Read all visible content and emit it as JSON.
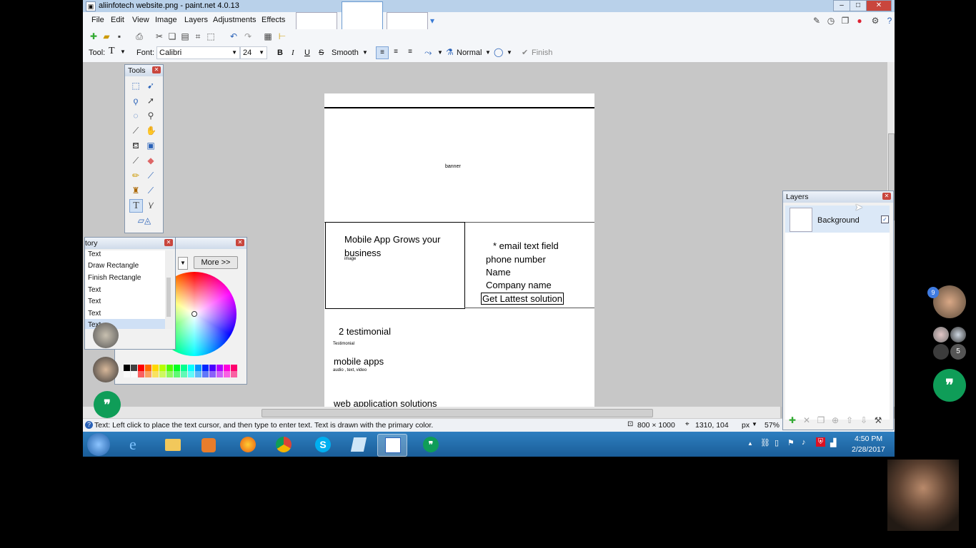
{
  "window": {
    "title": "aliinfotech website.png - paint.net 4.0.13"
  },
  "menu": [
    "File",
    "Edit",
    "View",
    "Image",
    "Layers",
    "Adjustments",
    "Effects"
  ],
  "toolbar2": {
    "tool_label": "Tool:",
    "font_label": "Font:",
    "font_value": "Calibri",
    "size_value": "24",
    "bold": "B",
    "italic": "I",
    "underline": "U",
    "strike": "S",
    "antialias": "Smooth",
    "blend": "Normal",
    "finish": "Finish"
  },
  "tools_panel": {
    "title": "Tools"
  },
  "history_panel": {
    "title": "tory",
    "items": [
      "Text",
      "Draw Rectangle",
      "Finish Rectangle",
      "Text",
      "Text",
      "Text",
      "Text"
    ]
  },
  "colors_panel": {
    "more_label": "More >>",
    "palette": [
      "#000000",
      "#404040",
      "#ff0000",
      "#ff6a00",
      "#ffd800",
      "#b6ff00",
      "#4cff00",
      "#00ff21",
      "#00ff90",
      "#00ffff",
      "#0094ff",
      "#0026ff",
      "#4800ff",
      "#b200ff",
      "#ff00dc",
      "#ff006e"
    ]
  },
  "layers_panel": {
    "title": "Layers",
    "layer_name": "Background"
  },
  "document": {
    "banner": "banner",
    "box_title_1": "Mobile App Grows your",
    "box_title_2": "business",
    "image_label": "image",
    "email": "* email text field",
    "phone": "phone number",
    "name": "Name",
    "company": "Company name",
    "button": "Get Lattest solution",
    "testimonial_heading": "2 testimonial",
    "testimonial_label": "Testimonial",
    "mobile_apps": "mobile apps",
    "mobile_sub": "audio , text, video",
    "web_app": "web application solutions"
  },
  "statusbar": {
    "help": "Text: Left click to place the text cursor, and then type to enter text. Text is drawn with the primary color.",
    "image_size": "800 × 1000",
    "cursor": "1310, 104",
    "units": "px",
    "zoom": "57%"
  },
  "taskbar": {
    "time": "4:50 PM",
    "date": "2/28/2017"
  },
  "hangouts": {
    "badge_count": "9",
    "group_count": "5"
  }
}
